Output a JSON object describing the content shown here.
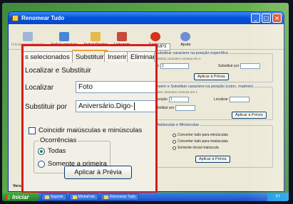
{
  "window": {
    "title": "Renomear Tudo",
    "controls": {
      "minimize": "_",
      "maximize": "□",
      "close": "×"
    }
  },
  "toolbar": {
    "items": [
      {
        "label": "Iniciar renomeação",
        "icon": "run-icon",
        "color": "#9fb6d6",
        "enabled": false
      },
      {
        "label": "Incluir arquivos",
        "icon": "add-files-icon",
        "color": "#4a86d8",
        "enabled": true
      },
      {
        "label": "Incluir Pastas",
        "icon": "add-folder-icon",
        "color": "#e5b94a",
        "enabled": true
      },
      {
        "label": "Listagem",
        "icon": "listing-icon",
        "color": "#c84a3a",
        "enabled": true
      },
      {
        "label": "Fechar",
        "icon": "close-circle-icon",
        "color": "#d8321f",
        "enabled": true
      },
      {
        "label": "Ajuda",
        "icon": "help-icon",
        "color": "#6a8fd6",
        "enabled": true
      }
    ]
  },
  "right_panel": {
    "tab": "MP3",
    "section1": {
      "title": "Substituir caractere na posição específica",
      "sub": "Substitui caractere começa em 1",
      "position_label": "ção",
      "position_value": "1",
      "replace_label": "Substituir por",
      "button": "Aplicar à Prévia"
    },
    "section2": {
      "title": "Inserir e Substituir caractere na posição (coinc. mai/min)",
      "sub": "Insere caractere começa em 1",
      "position_label": "Posição",
      "position_value": "1",
      "find_label": "Localizar",
      "replace_label": "Substituir por",
      "button": "Aplicar à Prévia"
    },
    "section3": {
      "title": "Maiúsculas e Minúsculas",
      "options": [
        "Converter tudo para minúsculas",
        "Converter tudo para maiúsculas",
        "Somente inicial maiúscula"
      ],
      "button": "Aplicar à Prévia"
    }
  },
  "zoom_panel": {
    "tabs": [
      "s selecionados",
      "Substituir",
      "Inserir",
      "Eliminar",
      "P"
    ],
    "active_tab": 1,
    "section_title": "Localizar e Substituir",
    "find_label": "Localizar",
    "find_value": "Foto",
    "replace_label": "Substituir por",
    "replace_value": "Aniversário.Digo-",
    "match_case_label": "Coincidir maiúsculas e minúsculas",
    "match_case_checked": false,
    "occurrences": {
      "title": "Ocorrências",
      "options": [
        {
          "label": "Todas",
          "selected": true
        },
        {
          "label": "Somente a primeira",
          "selected": false
        }
      ]
    },
    "apply_button": "Aplicar à Prévia",
    "highlight_color": "#d61c1c"
  },
  "status": {
    "version": "Versão 1.0.0"
  },
  "taskbar": {
    "start": "Iniciar",
    "tasks": [
      "Suporte",
      "MinhaFoto",
      "Renomear Tudo"
    ],
    "tray": "PT"
  }
}
